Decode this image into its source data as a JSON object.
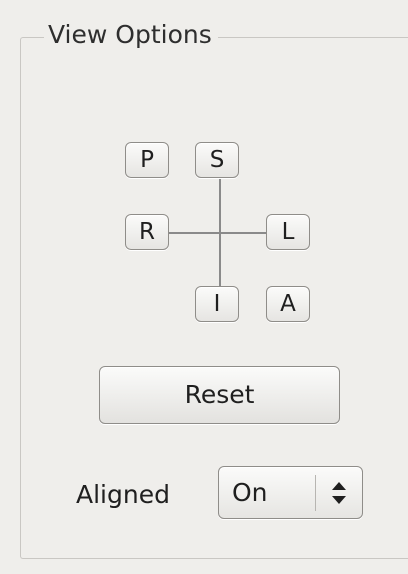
{
  "view_options": {
    "title": "View Options",
    "orientation": {
      "P": "P",
      "S": "S",
      "R": "R",
      "L": "L",
      "I": "I",
      "A": "A"
    },
    "reset_label": "Reset",
    "aligned": {
      "label": "Aligned",
      "value": "On",
      "icon": "up-down-arrows-icon"
    }
  }
}
